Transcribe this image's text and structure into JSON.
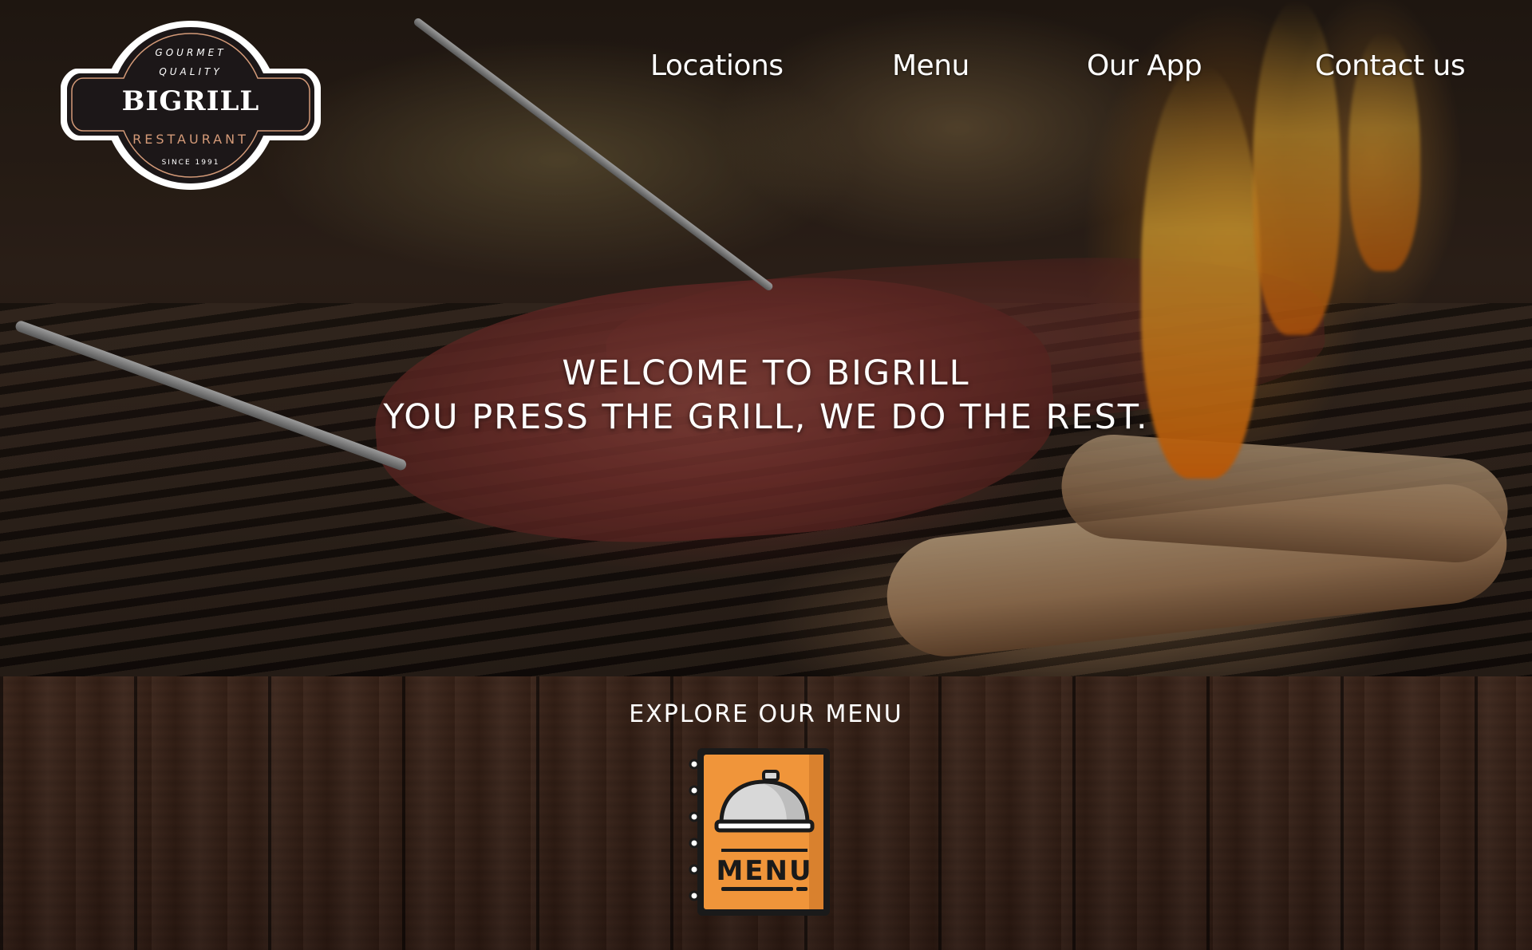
{
  "logo": {
    "line1": "GOURMET",
    "line2": "QUALITY",
    "name": "BIGRILL",
    "subtitle": "RESTAURANT",
    "since": "SINCE 1991"
  },
  "nav": {
    "items": [
      {
        "label": "Locations"
      },
      {
        "label": "Menu"
      },
      {
        "label": "Our App"
      },
      {
        "label": "Contact us"
      }
    ]
  },
  "hero": {
    "line1": "WELCOME TO BIGRILL",
    "line2": "YOU PRESS THE GRILL, WE DO THE REST."
  },
  "menu_section": {
    "heading": "EXPLORE OUR MENU",
    "icon_label": "MENU",
    "icon": "menu-cloche-icon"
  },
  "colors": {
    "menu_orange": "#f0953a",
    "logo_dark": "#1c1718",
    "logo_accent": "#d49a78"
  }
}
